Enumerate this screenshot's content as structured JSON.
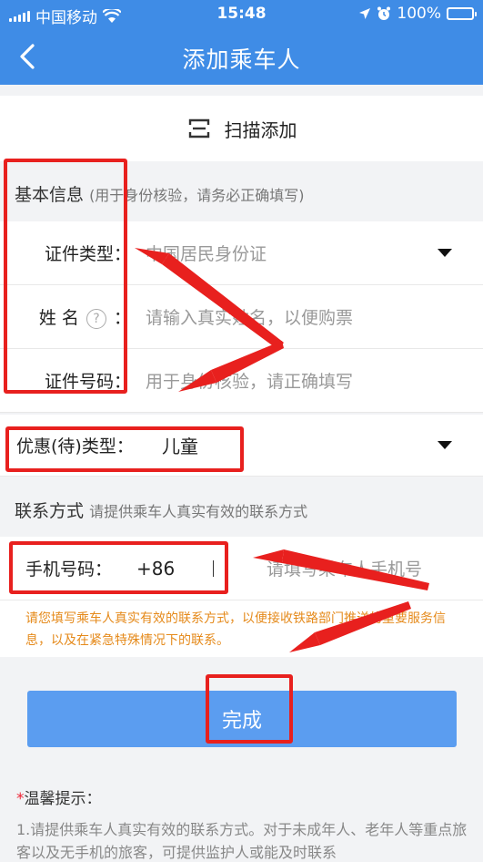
{
  "status_bar": {
    "carrier": "中国移动",
    "time": "15:48",
    "battery": "100%"
  },
  "nav": {
    "title": "添加乘车人"
  },
  "scan": {
    "label": "扫描添加"
  },
  "basic": {
    "title": "基本信息",
    "hint": "(用于身份核验，请务必正确填写)",
    "id_type_label": "证件类型：",
    "id_type_value": "中国居民身份证",
    "name_label_a": "姓 名",
    "name_label_b": "：",
    "name_placeholder": "请输入真实姓名，以便购票",
    "id_no_label": "证件号码：",
    "id_no_placeholder": "用于身份核验，请正确填写"
  },
  "discount": {
    "label": "优惠(待)类型：",
    "value": "儿童"
  },
  "contact": {
    "title": "联系方式",
    "hint": "请提供乘车人真实有效的联系方式",
    "phone_label": "手机号码：",
    "phone_prefix": "+86",
    "phone_placeholder": "请填写乘车人手机号",
    "notice": "请您填写乘车人真实有效的联系方式，以便接收铁路部门推送的重要服务信息，以及在紧急特殊情况下的联系。"
  },
  "submit": {
    "label": "完成"
  },
  "tips": {
    "title": "温馨提示：",
    "body": "1.请提供乘车人真实有效的联系方式。对于未成年人、老年人等重点旅客以及无手机的旅客，可提供监护人或能及时联系"
  },
  "colors": {
    "nav": "#3f8ce6",
    "button": "#5b9df0",
    "annotation": "#e8201e",
    "notice": "#e58a1b"
  }
}
